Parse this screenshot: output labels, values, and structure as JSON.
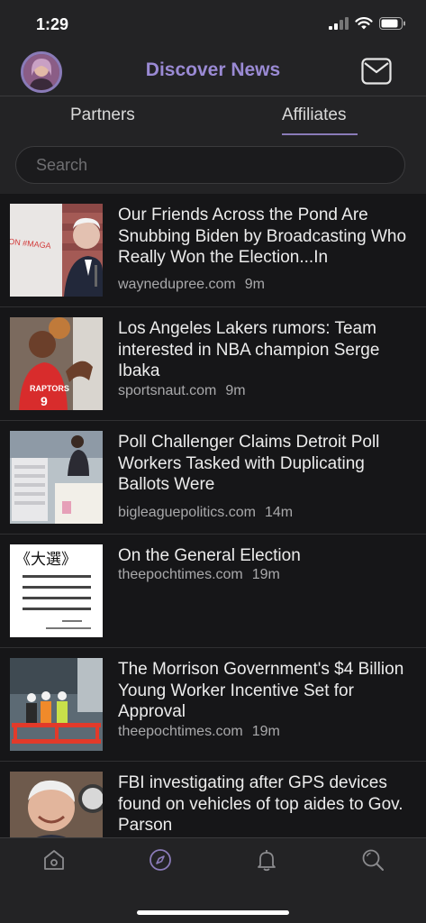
{
  "status_bar": {
    "time": "1:29"
  },
  "header": {
    "title": "Discover News"
  },
  "tabs": [
    {
      "label": "Partners",
      "active": false
    },
    {
      "label": "Affiliates",
      "active": true
    }
  ],
  "search": {
    "placeholder": "Search",
    "value": ""
  },
  "articles": [
    {
      "title": "Our Friends Across the Pond Are Snubbing Biden by Broadcasting Who Really Won the Election...In",
      "source": "waynedupree.com",
      "time": "9m",
      "thumb_text": "ON #MAGA"
    },
    {
      "title": "Los Angeles Lakers rumors: Team interested in NBA champion Serge Ibaka",
      "source": "sportsnaut.com",
      "time": "9m",
      "thumb_text": "RAPTORS"
    },
    {
      "title": "Poll Challenger Claims Detroit Poll Workers Tasked with Duplicating Ballots Were",
      "source": "bigleaguepolitics.com",
      "time": "14m"
    },
    {
      "title": "On the General Election",
      "source": "theepochtimes.com",
      "time": "19m",
      "thumb_text": "《大選》"
    },
    {
      "title": "The Morrison Government's $4 Billion Young Worker Incentive Set for Approval",
      "source": "theepochtimes.com",
      "time": "19m"
    },
    {
      "title": "FBI investigating after GPS devices found on vehicles of top aides to Gov. Parson",
      "source": "",
      "time": ""
    }
  ],
  "bottom_nav": [
    {
      "icon": "home-icon",
      "active": false
    },
    {
      "icon": "compass-icon",
      "active": true
    },
    {
      "icon": "bell-icon",
      "active": false
    },
    {
      "icon": "search-icon",
      "active": false
    }
  ],
  "colors": {
    "accent": "#8a7bb8",
    "title": "#9a8ad4",
    "background": "#161618",
    "bar": "#232325"
  }
}
